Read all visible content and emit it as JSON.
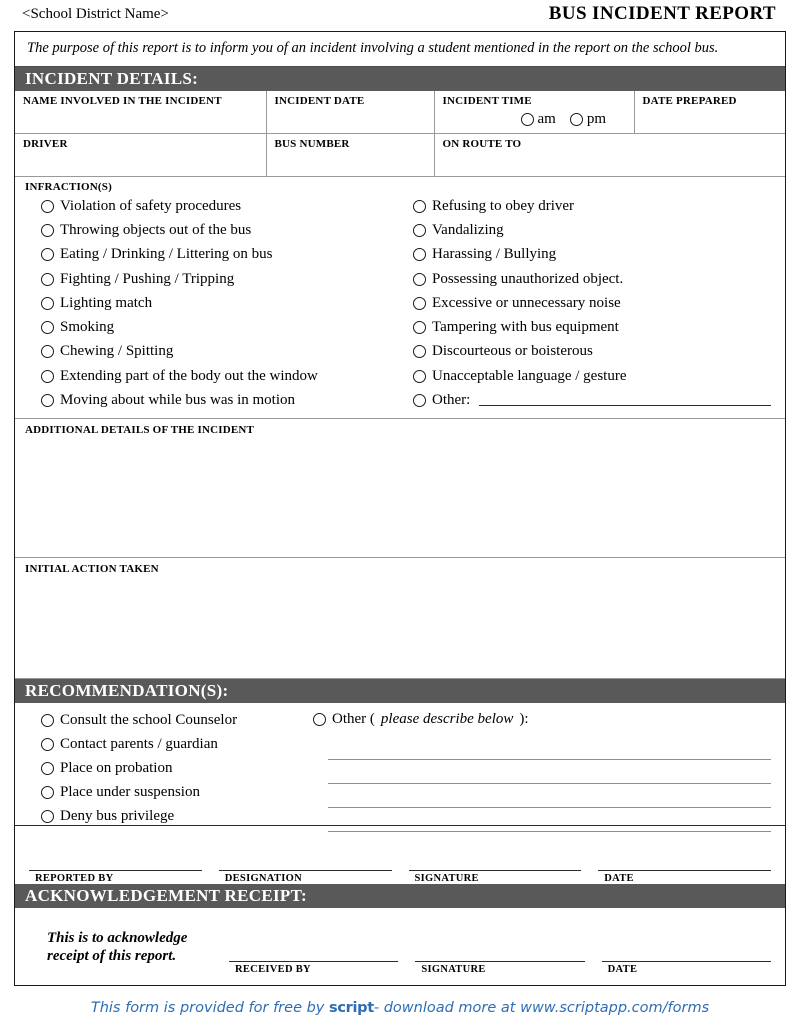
{
  "header": {
    "district_name": "<School District Name>",
    "document_title": "BUS INCIDENT REPORT"
  },
  "purpose": {
    "text": "The purpose of this report is to inform you of an incident involving a student mentioned in the report on the school bus."
  },
  "incident_details": {
    "banner": "INCIDENT DETAILS:",
    "fields": {
      "name_involved": "NAME INVOLVED IN THE INCIDENT",
      "incident_date": "INCIDENT DATE",
      "incident_time": "INCIDENT TIME",
      "date_prepared": "DATE PREPARED",
      "driver": "DRIVER",
      "bus_number": "BUS NUMBER",
      "on_route_to": "ON ROUTE TO"
    },
    "time_options": [
      "am",
      "pm"
    ]
  },
  "infractions": {
    "title": "INFRACTION(S)",
    "left": [
      "Violation of safety procedures",
      "Throwing objects out of the bus",
      "Eating / Drinking / Littering on bus",
      "Fighting / Pushing / Tripping",
      "Lighting match",
      "Smoking",
      "Chewing / Spitting",
      "Extending part of the body out the window",
      "Moving about while bus was in motion"
    ],
    "right": [
      "Refusing to obey driver",
      "Vandalizing",
      "Harassing / Bullying",
      "Possessing unauthorized object.",
      "Excessive or unnecessary noise",
      "Tampering with bus equipment",
      "Discourteous or boisterous",
      "Unacceptable language / gesture"
    ],
    "other_label": "Other:"
  },
  "additional_details": {
    "label": "ADDITIONAL DETAILS OF THE INCIDENT"
  },
  "initial_action": {
    "label": "INITIAL ACTION TAKEN"
  },
  "recommendations": {
    "banner": "RECOMMENDATION(S):",
    "options": [
      "Consult the school Counselor",
      "Contact parents / guardian",
      "Place on probation",
      "Place under suspension",
      "Deny bus privilege"
    ],
    "other_prefix": "Other (",
    "other_italic": "please describe below",
    "other_suffix": "):"
  },
  "signatures": {
    "reported_by": "REPORTED BY",
    "designation": "DESIGNATION",
    "signature": "SIGNATURE",
    "date": "DATE"
  },
  "acknowledgement": {
    "banner": "ACKNOWLEDGEMENT RECEIPT:",
    "note_line1": "This is to acknowledge",
    "note_line2": "receipt of this report.",
    "received_by": "RECEIVED BY",
    "signature": "SIGNATURE",
    "date": "DATE"
  },
  "footer": {
    "before": "This form is provided for free by ",
    "brand": "script",
    "after": "- download more at www.scriptapp.com/forms",
    "color": "#2E6DB4"
  },
  "colors": {
    "banner_bg": "#595959",
    "banner_text": "#FFFFFF",
    "border": "#1A1A1A",
    "grid": "#9A9A9A",
    "rule_light": "#8E8E8E"
  }
}
